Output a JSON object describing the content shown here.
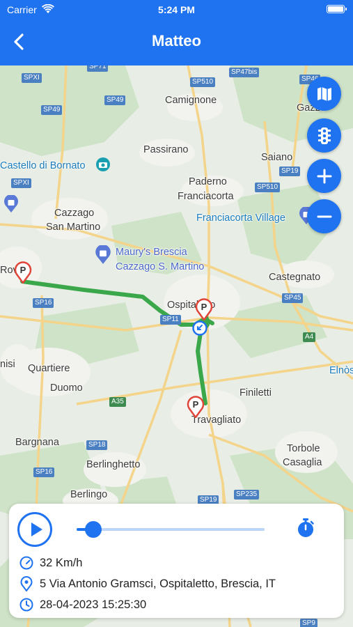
{
  "status_bar": {
    "carrier": "Carrier",
    "time": "5:24 PM"
  },
  "header": {
    "title": "Matteo",
    "back_icon": "chevron-left-icon"
  },
  "colors": {
    "accent": "#1f73f0",
    "route": "#3aa84a",
    "pin": "#e0453a"
  },
  "map": {
    "places": [
      "Camignone",
      "Passirano",
      "Saiano",
      "Paderno",
      "Franciacorta",
      "Cazzago",
      "San Martino",
      "Ospitaletto",
      "Castegnato",
      "Quartiere",
      "Duomo",
      "Finiletti",
      "Travagliato",
      "Bargnana",
      "Berlinghetto",
      "Berlingo",
      "Torbole",
      "Casaglia",
      "nisi",
      "Rov",
      "Gazzo",
      "Elnòs"
    ],
    "pois": [
      "Castello di Bornato",
      "Franciacorta Village",
      "Maury's Brescia",
      "Cazzago S. Martino"
    ],
    "roads": [
      "SP71",
      "SPXI",
      "SP510",
      "SP47bis",
      "SP46",
      "SP49",
      "SP49",
      "SP19",
      "SPXI",
      "SP510",
      "SP11",
      "SP16",
      "SP45",
      "A4",
      "A35",
      "SP18",
      "SP16",
      "SP19",
      "SP235",
      "SP9"
    ],
    "buttons": {
      "map_type_icon": "map-icon",
      "traffic_icon": "traffic-light-icon",
      "zoom_in_icon": "plus-icon",
      "zoom_out_icon": "minus-icon"
    }
  },
  "playback": {
    "play_icon": "play-icon",
    "progress": 0.09,
    "timer_icon": "stopwatch-icon",
    "speed": "32 Km/h",
    "address": "5 Via Antonio Gramsci, Ospitaletto, Brescia, IT",
    "datetime": "28-04-2023 15:25:30"
  }
}
